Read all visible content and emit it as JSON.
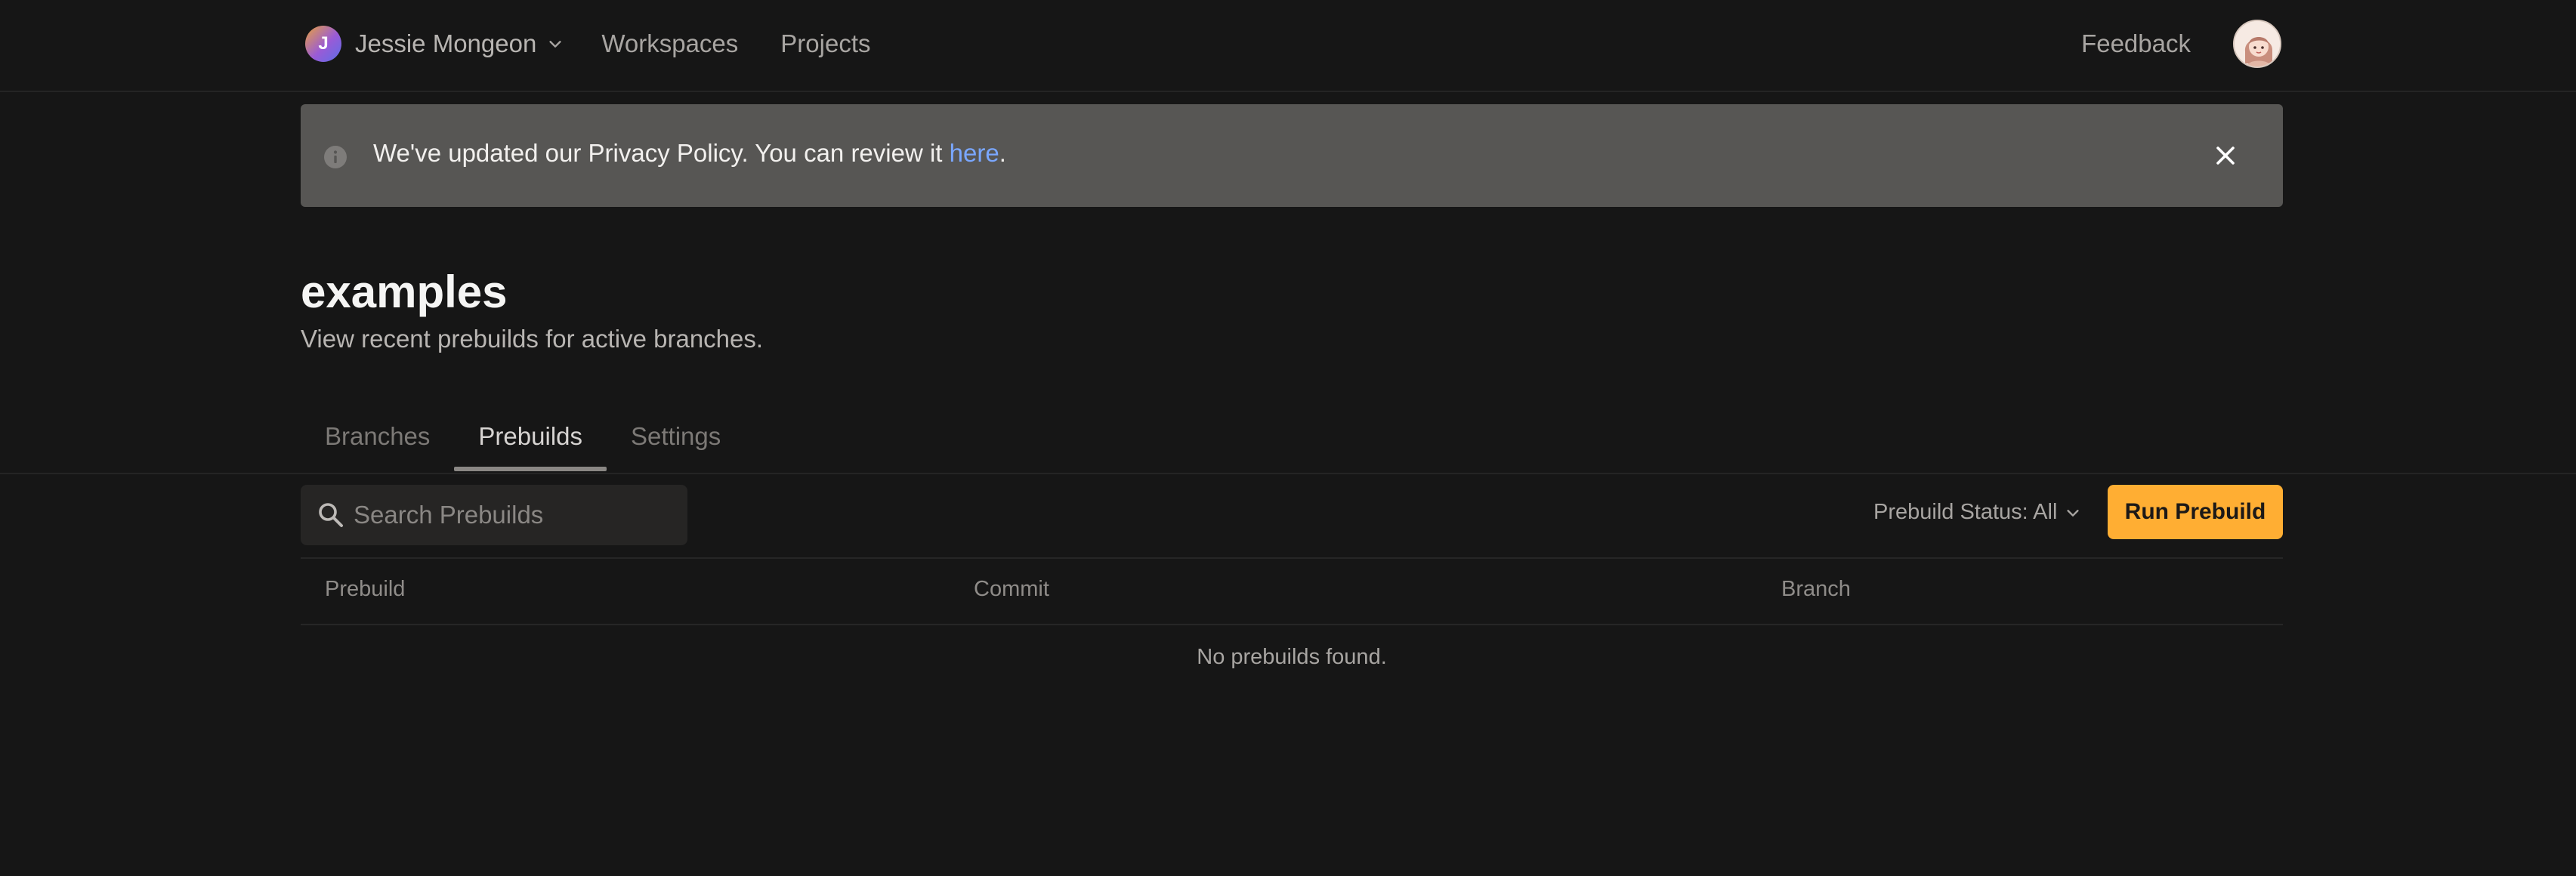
{
  "nav": {
    "org_initial": "J",
    "org_name": "Jessie Mongeon",
    "links": [
      "Workspaces",
      "Projects"
    ],
    "feedback": "Feedback"
  },
  "banner": {
    "text_before": "We've updated our Privacy Policy. You can review it ",
    "link": "here",
    "text_after": "."
  },
  "header": {
    "title": "examples",
    "subtitle": "View recent prebuilds for active branches."
  },
  "tabs": [
    "Branches",
    "Prebuilds",
    "Settings"
  ],
  "active_tab": "Prebuilds",
  "toolbar": {
    "search_placeholder": "Search Prebuilds",
    "status_filter": "Prebuild Status: All",
    "run_button": "Run Prebuild"
  },
  "table": {
    "columns": [
      "Prebuild",
      "Commit",
      "Branch"
    ],
    "empty_message": "No prebuilds found."
  },
  "colors": {
    "background": "#161616",
    "banner": "#575654",
    "accent": "#ffae33",
    "link": "#7aa7ff"
  },
  "icons": [
    "chevron-down-icon",
    "info-icon",
    "close-icon",
    "search-icon"
  ]
}
